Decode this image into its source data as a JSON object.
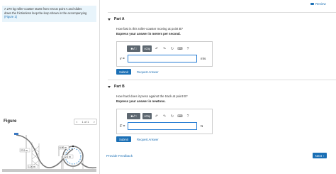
{
  "header": {
    "review_label": "Review"
  },
  "problem": {
    "line1": "A 270 kg roller-coaster starts from rest at point A and slides",
    "line2": "down the frictionless loop-the-loop shown in the accompanying",
    "figure_link": "(Figure 1)"
  },
  "figure": {
    "title": "Figure",
    "pager": {
      "label": "1 of 1",
      "prev": "<",
      "next": ">"
    },
    "labels": {
      "h_a": "27.0 m",
      "h_b": "6.90 m",
      "h_c": "12.0 m",
      "base": "1.00 m"
    }
  },
  "part_a": {
    "title": "Part A",
    "question": "How fast is this roller-coaster moving at point B?",
    "instruction": "Express your answer in meters per second.",
    "toolbar": {
      "frac": "■√□",
      "sym": "ΑΣφ",
      "help": "?"
    },
    "variable": "v",
    "equals": " =",
    "unit": "m/s",
    "input_value": "",
    "submit_label": "Submit",
    "request_label": "Request Answer"
  },
  "part_b": {
    "title": "Part B",
    "question": "How hard does it press against the track at point B?",
    "instruction": "Express your answer in newtons.",
    "toolbar": {
      "frac": "■√□",
      "sym": "ΑΣφ",
      "help": "?"
    },
    "variable": "F",
    "equals": " =",
    "unit": "N",
    "input_value": "",
    "submit_label": "Submit",
    "request_label": "Request Answer"
  },
  "footer": {
    "feedback_label": "Provide Feedback",
    "next_label": "Next"
  },
  "colors": {
    "accent": "#1a6fb5",
    "problem_bg": "#e8f4fb",
    "toolbar": "#5d6770"
  }
}
